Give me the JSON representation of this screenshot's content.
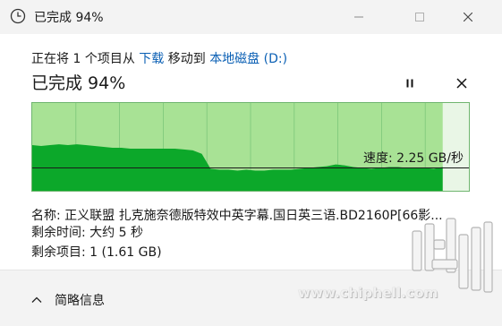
{
  "window": {
    "title": "已完成 94%",
    "icon": "clock-icon"
  },
  "progress": {
    "fraction": 0.94,
    "line_prefix": "正在将",
    "count_text": "1",
    "unit_text": "个项目从",
    "source": "下载",
    "middle_text": "移动到",
    "destination": "本地磁盘 (D:)",
    "heading": "已完成 94%"
  },
  "controls": {
    "pause_icon": "pause-icon",
    "cancel_icon": "close-icon"
  },
  "speed": {
    "label": "速度: 2.25 GB/秒"
  },
  "chart_data": {
    "type": "area",
    "title": "",
    "xlabel": "",
    "ylabel": "",
    "progress_fraction": 0.94,
    "series": [
      {
        "values": [
          0.52,
          0.51,
          0.52,
          0.53,
          0.52,
          0.53,
          0.52,
          0.51,
          0.5,
          0.49,
          0.49,
          0.48,
          0.48,
          0.48,
          0.48,
          0.48,
          0.48,
          0.47,
          0.46,
          0.42,
          0.25,
          0.24,
          0.24,
          0.23,
          0.24,
          0.23,
          0.23,
          0.24,
          0.24,
          0.24,
          0.25,
          0.26,
          0.27,
          0.28,
          0.3,
          0.29,
          0.27,
          0.26,
          0.25,
          0.26,
          0.27,
          0.27,
          0.26,
          0.26,
          0.26,
          0.25,
          0.27
        ]
      }
    ],
    "current_speed": "2.25 GB/秒",
    "colors": {
      "fill": "#0ca82a",
      "background": "#a8e295",
      "remaining": "#e9f6e6",
      "grid": "#7cc77a",
      "line": "#1a1a1a"
    }
  },
  "details": {
    "name_label": "名称:",
    "name_value": "正义联盟 扎克施奈德版特效中英字幕.国日英三语.BD2160P[66影...",
    "time_label": "剩余时间:",
    "time_value": "大约 5 秒",
    "items_label": "剩余项目:",
    "items_value": "1 (1.61 GB)"
  },
  "footer": {
    "toggle_label": "简略信息"
  },
  "watermark": {
    "url": "www.chiphell.com",
    "logo_text": "chiphell"
  }
}
